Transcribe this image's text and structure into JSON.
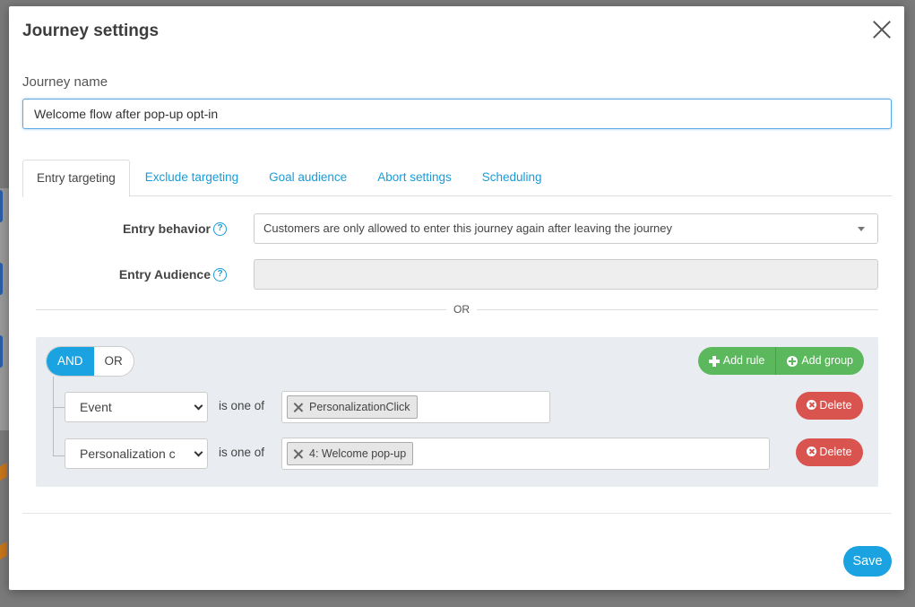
{
  "modal": {
    "title": "Journey settings",
    "journey_name_label": "Journey name",
    "journey_name_value": "Welcome flow after pop-up opt-in"
  },
  "tabs": [
    {
      "label": "Entry targeting",
      "active": true
    },
    {
      "label": "Exclude targeting",
      "active": false
    },
    {
      "label": "Goal audience",
      "active": false
    },
    {
      "label": "Abort settings",
      "active": false
    },
    {
      "label": "Scheduling",
      "active": false
    }
  ],
  "entry": {
    "behavior_label": "Entry behavior",
    "behavior_value": "Customers are only allowed to enter this journey again after leaving the journey",
    "audience_label": "Entry Audience",
    "audience_value": "",
    "or_text": "OR"
  },
  "rules": {
    "toggle": {
      "and_label": "AND",
      "or_label": "OR",
      "selected": "AND"
    },
    "add_rule_label": "Add rule",
    "add_group_label": "Add group",
    "items": [
      {
        "field": "Event",
        "operator": "is one of",
        "tags": [
          "PersonalizationClick"
        ],
        "delete_label": "Delete"
      },
      {
        "field": "Personalization c",
        "operator": "is one of",
        "tags": [
          "4: Welcome pop-up"
        ],
        "delete_label": "Delete"
      }
    ]
  },
  "footer": {
    "save_label": "Save"
  },
  "colors": {
    "primary": "#1aa3e0",
    "success": "#5cb85c",
    "danger": "#d9534f"
  }
}
